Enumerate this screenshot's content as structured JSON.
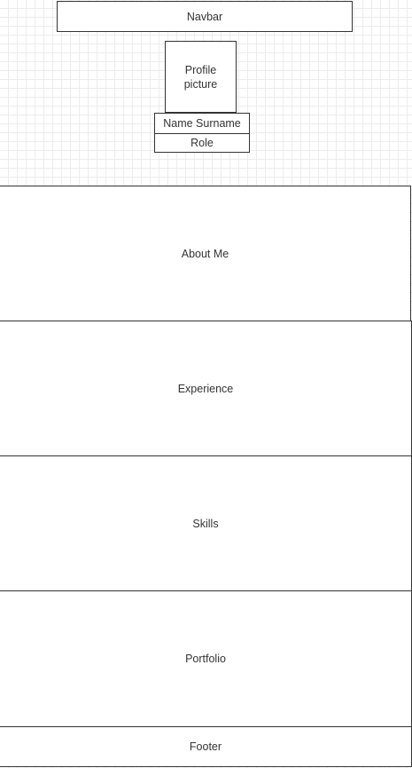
{
  "wireframe": {
    "navbar": "Navbar",
    "profile_picture": "Profile\npicture",
    "name": "Name Surname",
    "role": "Role",
    "sections": {
      "about": "About Me",
      "experience": "Experience",
      "skills": "Skills",
      "portfolio": "Portfolio"
    },
    "footer": "Footer"
  }
}
